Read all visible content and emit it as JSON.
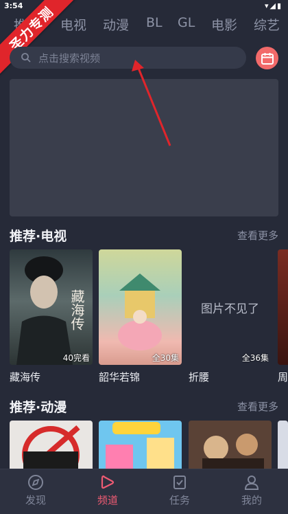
{
  "status_bar": {
    "time": "3:54"
  },
  "banner_ribbon": {
    "text": "圣力专测"
  },
  "category_tabs": [
    "推荐",
    "电视",
    "动漫",
    "BL",
    "GL",
    "电影",
    "综艺"
  ],
  "search": {
    "placeholder": "点击搜索视频"
  },
  "sections": [
    {
      "title": "推荐·电视",
      "more": "查看更多",
      "items": [
        {
          "title": "藏海传",
          "badge": "40完看",
          "poster_text": "藏海传"
        },
        {
          "title": "韶华若锦",
          "badge": "全30集"
        },
        {
          "title": "折腰",
          "badge": "全36集",
          "missing_text": "图片不见了"
        },
        {
          "title": "周"
        }
      ]
    },
    {
      "title": "推荐·动漫",
      "more": "查看更多"
    }
  ],
  "bottom_nav": [
    {
      "label": "发现",
      "icon": "compass-icon",
      "active": false
    },
    {
      "label": "频道",
      "icon": "play-icon",
      "active": true
    },
    {
      "label": "任务",
      "icon": "task-check-icon",
      "active": false
    },
    {
      "label": "我的",
      "icon": "user-icon",
      "active": false
    }
  ],
  "colors": {
    "accent": "#ef5b73",
    "ribbon": "#e0252b",
    "calendar": "#f26a6a",
    "background": "#262a38"
  }
}
